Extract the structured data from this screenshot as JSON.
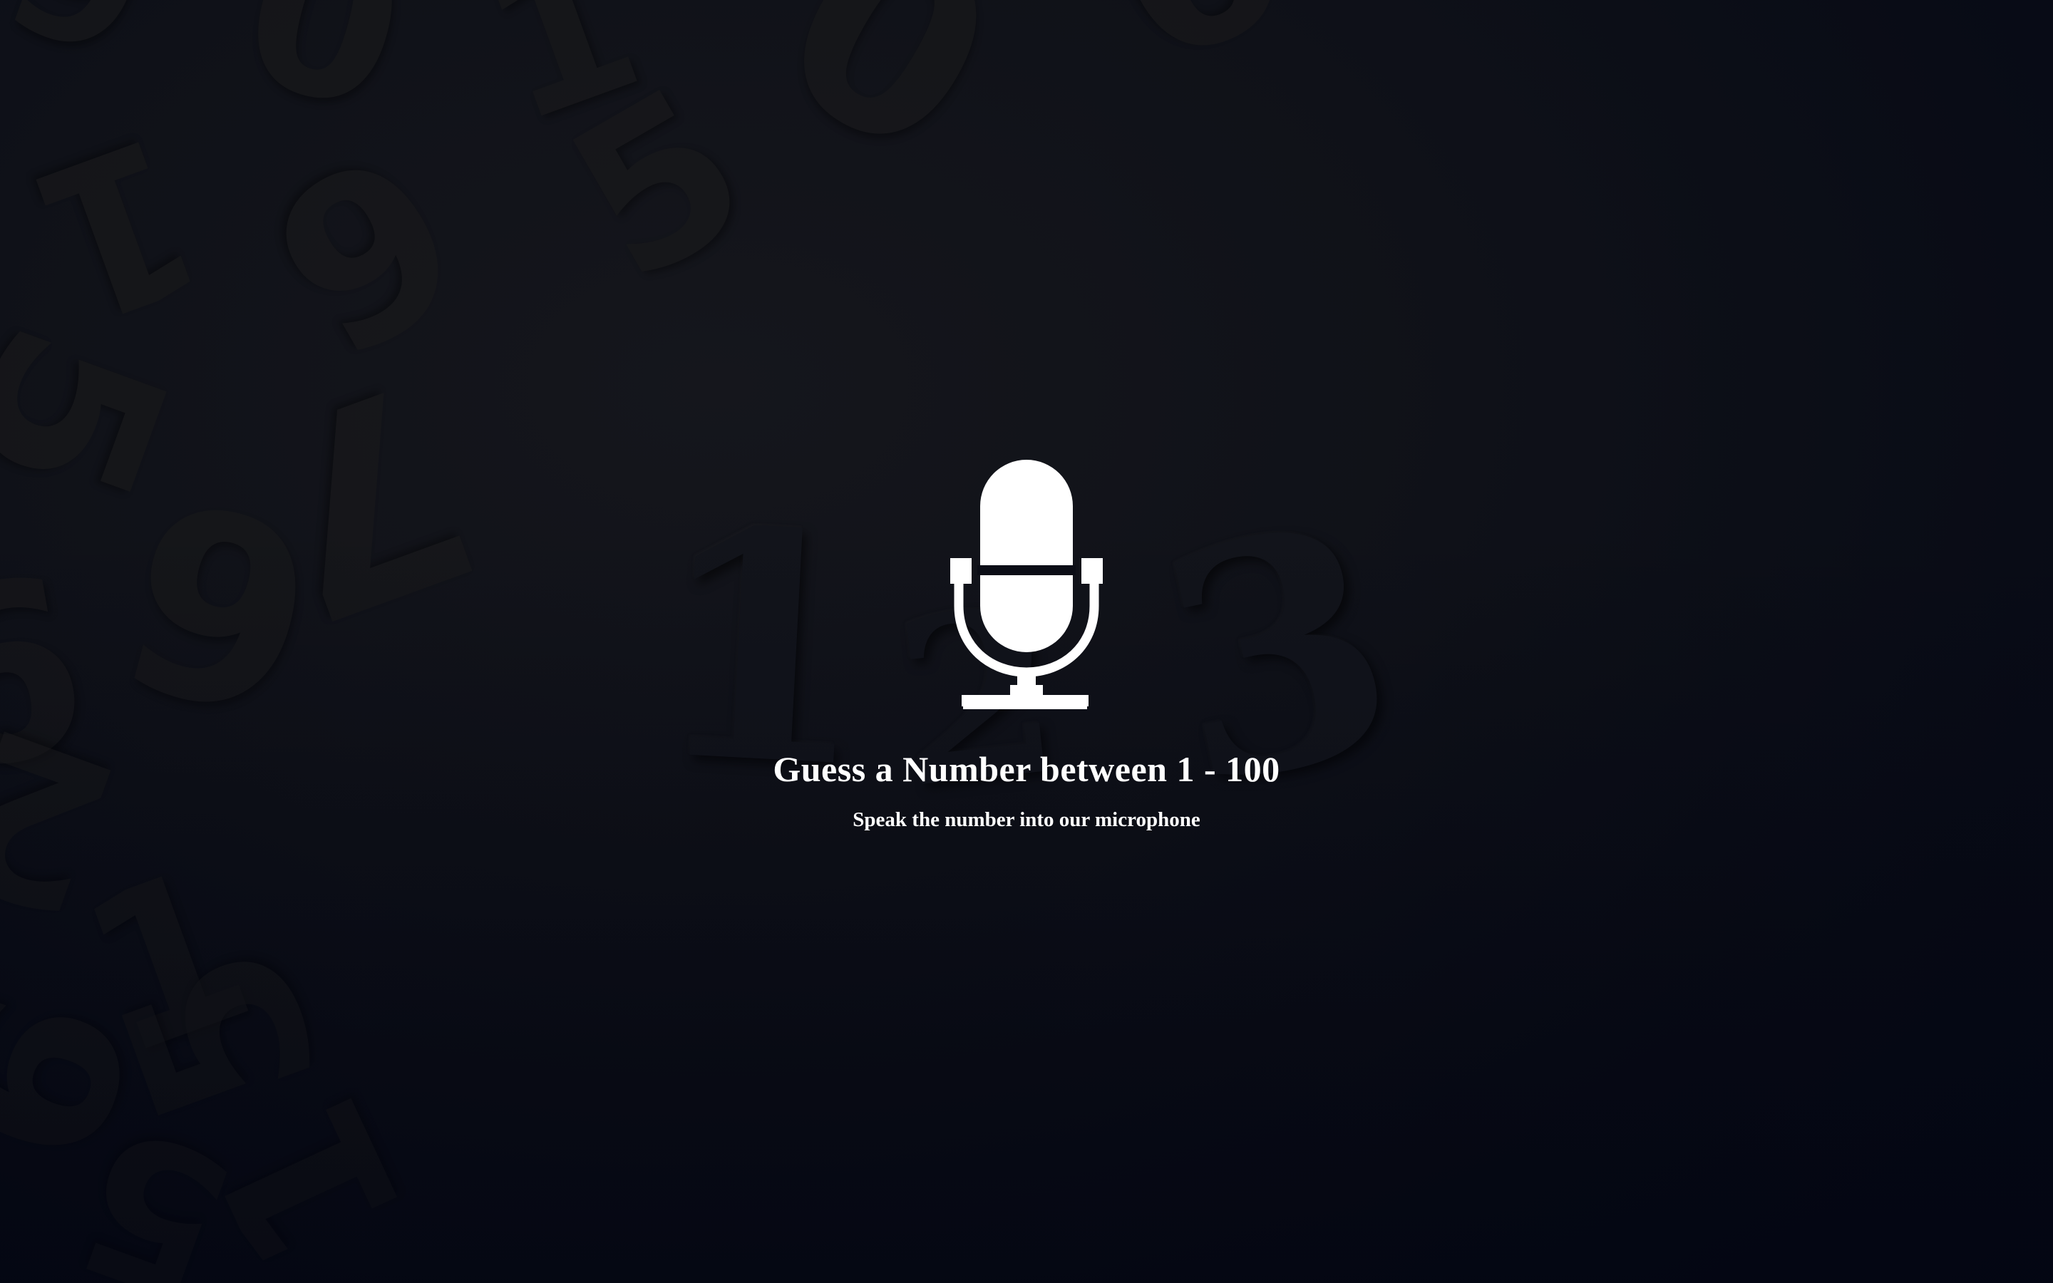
{
  "game": {
    "title": "Guess a Number between 1 - 100",
    "subtitle": "Speak the number into our microphone",
    "mic_icon": "microphone-icon"
  },
  "background": {
    "scattered_digits": [
      "9",
      "0",
      "1",
      "0",
      "9",
      "1",
      "5",
      "6",
      "5",
      "7",
      "9",
      "6",
      "2",
      "1",
      "5",
      "6",
      "5",
      "1"
    ],
    "center_digits": [
      "1",
      "2",
      "3"
    ],
    "colors": {
      "base": "#0b0d16",
      "digit": "#1a1a1a",
      "text": "#ffffff"
    }
  }
}
